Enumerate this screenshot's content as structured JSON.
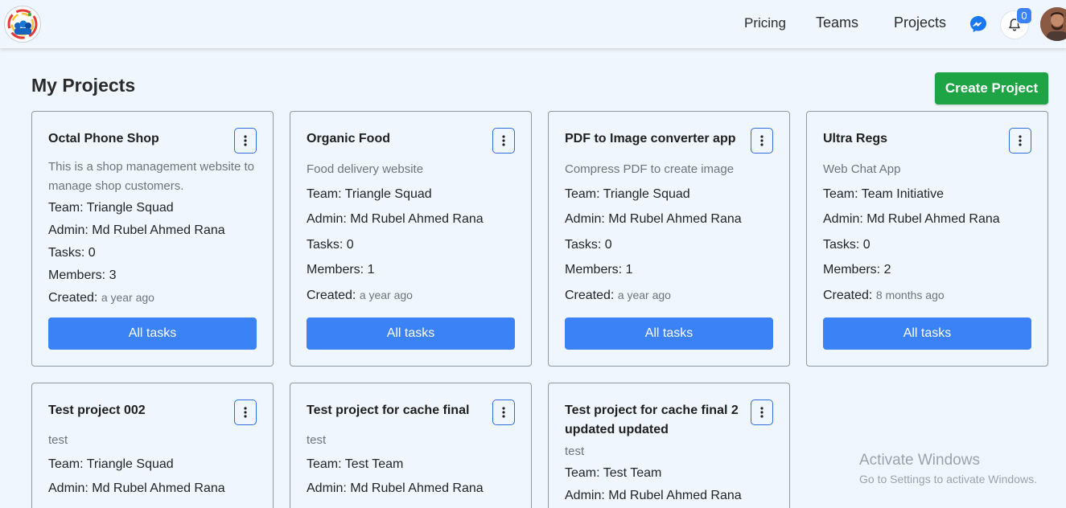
{
  "nav": {
    "links": [
      "Pricing",
      "Teams",
      "Projects"
    ],
    "notification_count": "0",
    "icons": [
      "app-logo",
      "messenger-icon",
      "bell-icon",
      "avatar"
    ]
  },
  "page": {
    "title": "My Projects",
    "create_label": "Create Project"
  },
  "labels": {
    "team": "Team: ",
    "admin": "Admin: ",
    "tasks": "Tasks: ",
    "members": "Members: ",
    "created": "Created: ",
    "all_tasks": "All tasks"
  },
  "projects": [
    {
      "name": "Octal Phone Shop",
      "description": "This is a shop management website to manage shop customers.",
      "team": "Triangle Squad",
      "admin": "Md Rubel Ahmed Rana",
      "tasks": "0",
      "members": "3",
      "created": "a year ago"
    },
    {
      "name": "Organic Food",
      "description": "Food delivery website",
      "team": "Triangle Squad",
      "admin": "Md Rubel Ahmed Rana",
      "tasks": "0",
      "members": "1",
      "created": "a year ago"
    },
    {
      "name": "PDF to Image converter app",
      "description": "Compress PDF to create image",
      "team": "Triangle Squad",
      "admin": "Md Rubel Ahmed Rana",
      "tasks": "0",
      "members": "1",
      "created": "a year ago"
    },
    {
      "name": "Ultra Regs",
      "description": "Web Chat App",
      "team": "Team Initiative",
      "admin": "Md Rubel Ahmed Rana",
      "tasks": "0",
      "members": "2",
      "created": "8 months ago"
    },
    {
      "name": "Test project 002",
      "description": "test",
      "team": "Triangle Squad",
      "admin": "Md Rubel Ahmed Rana"
    },
    {
      "name": "Test project for cache final",
      "description": "test",
      "team": "Test Team",
      "admin": "Md Rubel Ahmed Rana"
    },
    {
      "name": "Test project for cache final 2 updated updated",
      "description": "test",
      "team": "Test Team",
      "admin": "Md Rubel Ahmed Rana"
    }
  ],
  "watermark": {
    "title": "Activate Windows",
    "subtitle": "Go to Settings to activate Windows."
  },
  "colors": {
    "background": "#f0f6fd",
    "primary": "#3b82f6",
    "success": "#1ea345",
    "outline": "#2e6ee0"
  }
}
